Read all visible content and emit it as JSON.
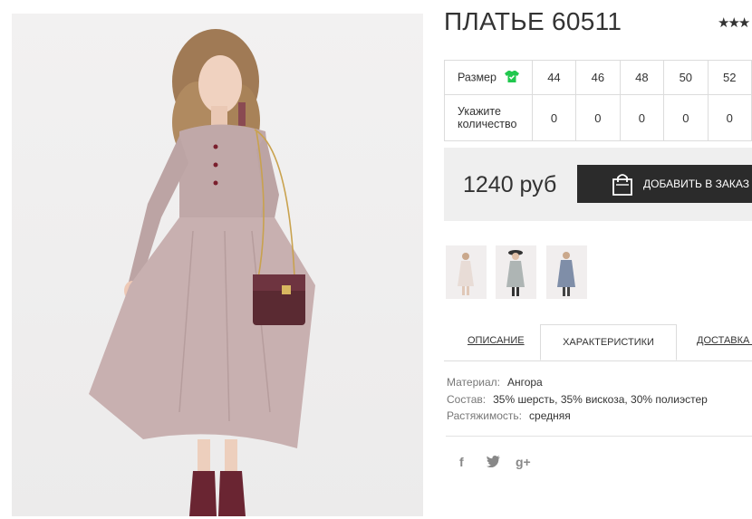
{
  "product": {
    "title": "ПЛАТЬЕ 60511",
    "rating_stars": "★★★",
    "photo_description": "model in pink long-sleeve knit dress with bag"
  },
  "size_table": {
    "size_label": "Размер",
    "qty_label": "Укажите количество",
    "sizes": [
      "44",
      "46",
      "48",
      "50",
      "52"
    ],
    "quantities": [
      "0",
      "0",
      "0",
      "0",
      "0"
    ],
    "icon": "tshirt-icon"
  },
  "purchase": {
    "price": "1240 руб",
    "add_button_label": "ДОБАВИТЬ В ЗАКАЗ",
    "button_icon": "shopping-bag-icon"
  },
  "thumbnails": [
    {
      "color": "#e8dcd6"
    },
    {
      "color": "#aeb5b4"
    },
    {
      "color": "#7f8ea8"
    }
  ],
  "tabs": {
    "description": "ОПИСАНИЕ",
    "characteristics": "ХАРАКТЕРИСТИКИ",
    "delivery": "ДОСТАВКА И"
  },
  "specs": [
    {
      "key": "Материал:",
      "value": "Ангора"
    },
    {
      "key": "Состав:",
      "value": "35% шерсть, 35% вискоза, 30% полиэстер"
    },
    {
      "key": "Растяжимость:",
      "value": "средняя"
    }
  ],
  "social": {
    "facebook": "f",
    "twitter_icon": "twitter-icon",
    "google_plus": "g+"
  },
  "colors": {
    "dark": "#2b2b2b",
    "price_bg": "#efefef",
    "accent_green": "#21c84e"
  }
}
